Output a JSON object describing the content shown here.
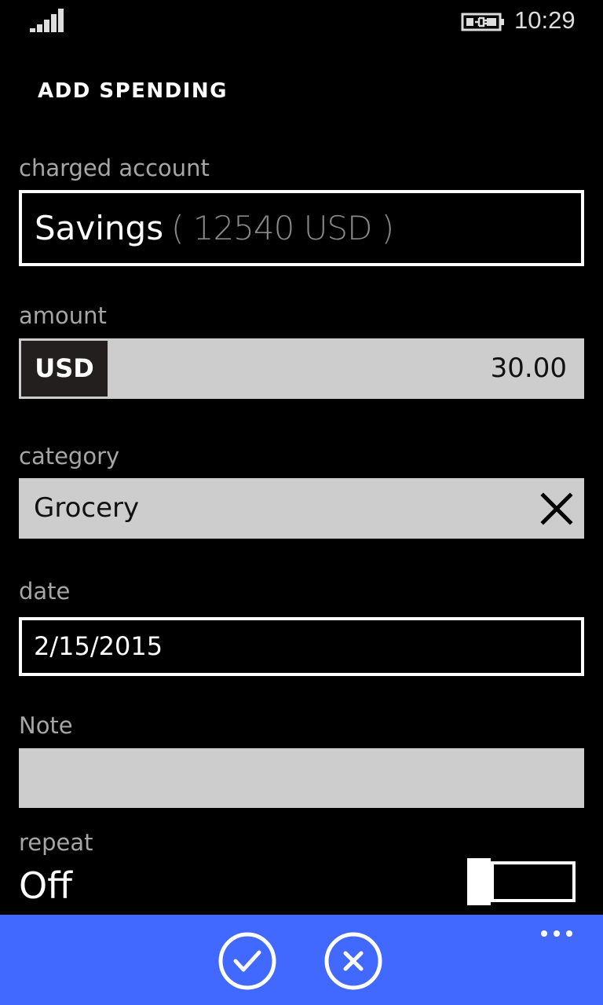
{
  "status_bar": {
    "time": "10:29",
    "signal_icon": "signal-strength-icon",
    "battery_icon": "battery-charging-icon"
  },
  "page": {
    "title": "ADD SPENDING"
  },
  "charged_account": {
    "label": "charged account",
    "name": "Savings",
    "balance": "( 12540 USD )"
  },
  "amount": {
    "label": "amount",
    "currency": "USD",
    "value": "30.00"
  },
  "category": {
    "label": "category",
    "value": "Grocery",
    "clear_icon": "close-icon"
  },
  "date": {
    "label": "date",
    "value": "2/15/2015"
  },
  "note": {
    "label": "Note",
    "value": ""
  },
  "repeat": {
    "label": "repeat",
    "state": "Off",
    "on": false
  },
  "app_bar": {
    "accent_color": "#4169ff",
    "buttons": [
      {
        "icon": "check-icon",
        "action": "save"
      },
      {
        "icon": "cancel-icon",
        "action": "cancel"
      }
    ],
    "more_icon": "more-icon"
  }
}
